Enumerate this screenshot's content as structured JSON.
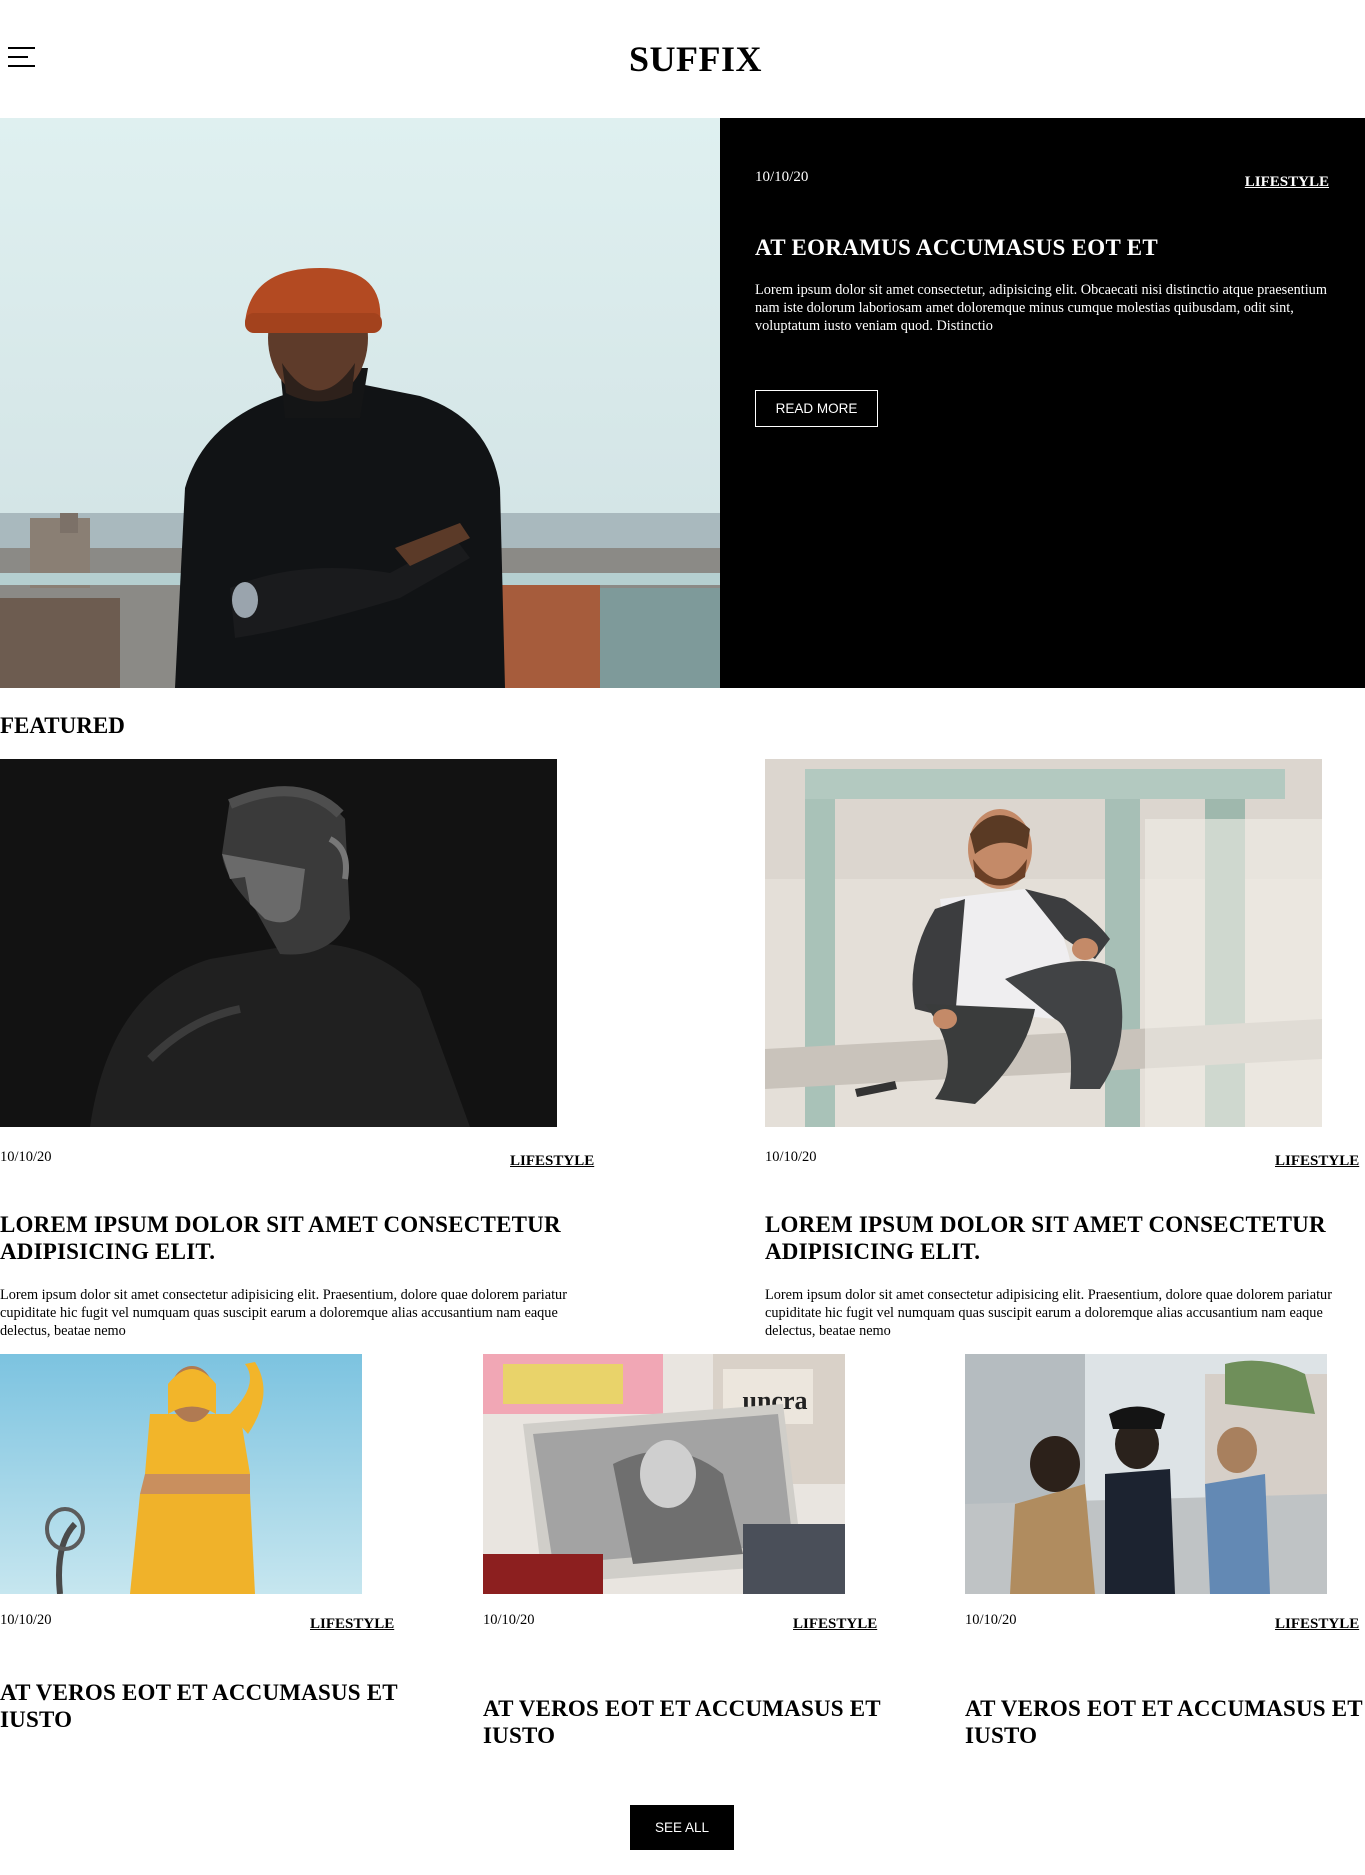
{
  "header": {
    "logo": "SUFFIX",
    "menu_icon": "hamburger-menu-icon"
  },
  "hero": {
    "date": "10/10/20",
    "category": "LIFESTYLE",
    "title": "AT EORAMUS ACCUMASUS EOT ET",
    "text": "Lorem ipsum dolor sit amet consectetur, adipisicing elit. Obcaecati nisi distinctio atque praesentium nam iste dolorum laboriosam amet doloremque minus cumque molestias quibusdam, odit sint, voluptatum iusto veniam quod. Distinctio",
    "button": "READ MORE"
  },
  "featured": {
    "heading": "FEATURED",
    "cards": [
      {
        "date": "10/10/20",
        "category": "LIFESTYLE",
        "title": "LOREM IPSUM DOLOR SIT AMET CONSECTETUR ADIPISICING ELIT.",
        "excerpt": "Lorem ipsum dolor sit amet consectetur adipisicing elit. Praesentium, dolore quae dolorem pariatur cupiditate hic fugit vel numquam quas suscipit earum a doloremque alias accusantium nam eaque delectus, beatae nemo"
      },
      {
        "date": "10/10/20",
        "category": "LIFESTYLE",
        "title": "LOREM IPSUM DOLOR SIT AMET CONSECTETUR ADIPISICING ELIT.",
        "excerpt": "Lorem ipsum dolor sit amet consectetur adipisicing elit. Praesentium, dolore quae dolorem pariatur cupiditate hic fugit vel numquam quas suscipit earum a doloremque alias accusantium nam eaque delectus, beatae nemo"
      }
    ]
  },
  "small_cards": [
    {
      "date": "10/10/20",
      "category": "LIFESTYLE",
      "title": "AT VEROS EOT ET ACCUMASUS ET IUSTO"
    },
    {
      "date": "10/10/20",
      "category": "LIFESTYLE",
      "title": "AT VEROS EOT ET ACCUMASUS ET IUSTO"
    },
    {
      "date": "10/10/20",
      "category": "LIFESTYLE",
      "title": "AT VEROS EOT ET ACCUMASUS ET IUSTO"
    }
  ],
  "see_all": "SEE ALL"
}
